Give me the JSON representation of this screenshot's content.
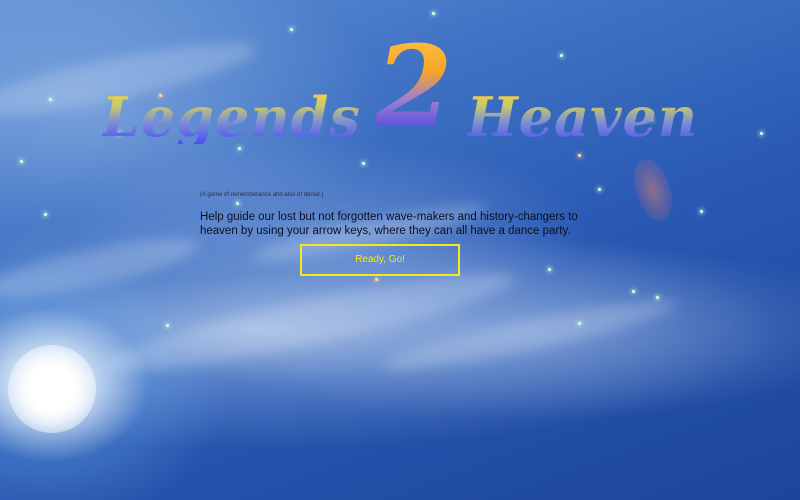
{
  "title": {
    "word_left": "Legends",
    "number": "2",
    "word_right": "Heaven"
  },
  "subtitle": "(A game of rememberance and also of denial.)",
  "instructions": "Help guide our lost but not forgotten wave-makers and history-changers to heaven by using your arrow keys, where they can all have a dance party.",
  "start_button": {
    "label": "Ready, Go!"
  },
  "colors": {
    "button_border": "#f4ea1b",
    "button_text": "#f4ea1b",
    "sky_top": "#5f90d3",
    "sky_bottom": "#1d459a"
  }
}
